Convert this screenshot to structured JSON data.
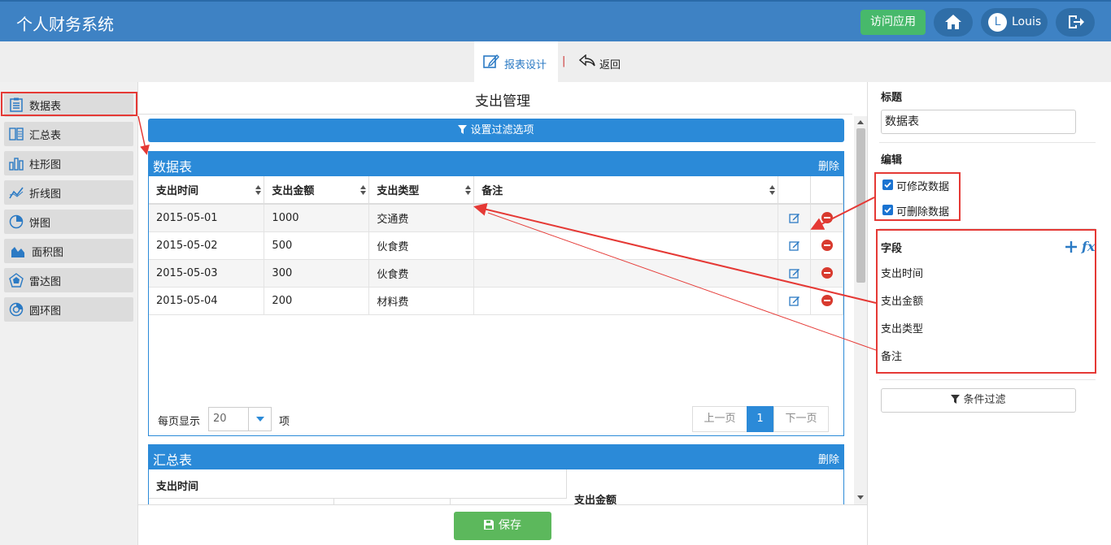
{
  "header": {
    "app_title": "个人财务系统",
    "visit_label": "访问应用",
    "user_initial": "L",
    "user_name": "Louis"
  },
  "subbar": {
    "design_tab": "报表设计",
    "separator": "|",
    "back_tab": "返回"
  },
  "sidebar": {
    "items": [
      {
        "label": "数据表",
        "icon": "table-icon"
      },
      {
        "label": "汇总表",
        "icon": "summary-table-icon"
      },
      {
        "label": "柱形图",
        "icon": "bar-chart-icon"
      },
      {
        "label": "折线图",
        "icon": "line-chart-icon"
      },
      {
        "label": "饼图",
        "icon": "pie-chart-icon"
      },
      {
        "label": "面积图",
        "icon": "area-chart-icon"
      },
      {
        "label": "雷达图",
        "icon": "radar-chart-icon"
      },
      {
        "label": "圆环图",
        "icon": "donut-chart-icon"
      }
    ]
  },
  "main": {
    "page_title": "支出管理",
    "filter_button": "设置过滤选项",
    "data_panel": {
      "title": "数据表",
      "delete_label": "删除",
      "columns": [
        "支出时间",
        "支出金额",
        "支出类型",
        "备注"
      ],
      "rows": [
        [
          "2015-05-01",
          "1000",
          "交通费",
          ""
        ],
        [
          "2015-05-02",
          "500",
          "伙食费",
          ""
        ],
        [
          "2015-05-03",
          "300",
          "伙食费",
          ""
        ],
        [
          "2015-05-04",
          "200",
          "材料费",
          ""
        ]
      ],
      "page_size_label": "每页显示",
      "page_size": "20",
      "page_size_unit": "项",
      "prev": "上一页",
      "current_page": "1",
      "next": "下一页"
    },
    "summary_panel": {
      "title": "汇总表",
      "delete_label": "删除",
      "col1": "支出时间",
      "col2": "支出金额"
    },
    "save_button": "保存"
  },
  "right_panel": {
    "title_label": "标题",
    "title_value": "数据表",
    "edit_label": "编辑",
    "can_edit": "可修改数据",
    "can_delete": "可删除数据",
    "fields_label": "字段",
    "fx_label": "fx",
    "fields": [
      "支出时间",
      "支出金额",
      "支出类型",
      "备注"
    ],
    "condition_filter": "条件过滤"
  },
  "colors": {
    "brand": "#3e82c4",
    "accent": "#2b8ad8",
    "success": "#5cb85c",
    "highlight": "#e53935"
  }
}
